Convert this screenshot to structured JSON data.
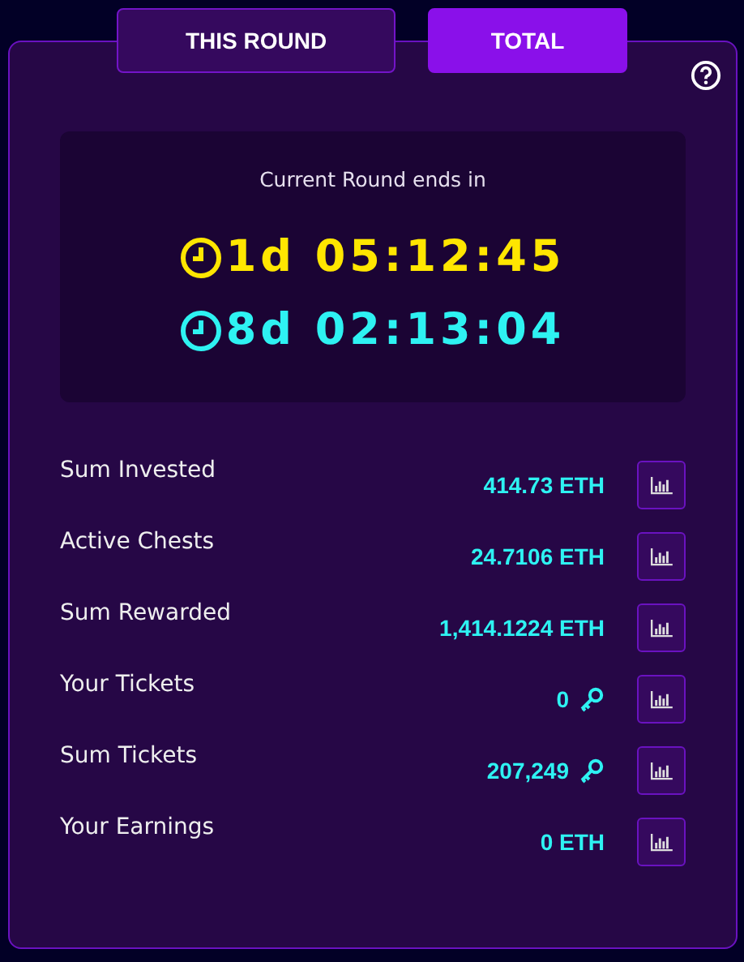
{
  "tabs": [
    {
      "label": "THIS ROUND",
      "selected": false
    },
    {
      "label": "TOTAL",
      "selected": true
    }
  ],
  "countdown": {
    "caption": "Current Round ends in",
    "timers": [
      {
        "value": "1d 05:12:45",
        "color": "#ffe600"
      },
      {
        "value": "8d 02:13:04",
        "color": "#2ef2f2"
      }
    ]
  },
  "stats": [
    {
      "label": "Sum Invested",
      "value": "414.73 ETH",
      "kind": "amount"
    },
    {
      "label": "Active Chests",
      "value": "24.7106 ETH",
      "kind": "amount"
    },
    {
      "label": "Sum Rewarded",
      "value": "1,414.1224 ETH",
      "kind": "amount"
    },
    {
      "label": "Your Tickets",
      "value": "0",
      "kind": "tickets"
    },
    {
      "label": "Sum Tickets",
      "value": "207,249",
      "kind": "tickets"
    },
    {
      "label": "Your Earnings",
      "value": "0 ETH",
      "kind": "amount"
    }
  ]
}
